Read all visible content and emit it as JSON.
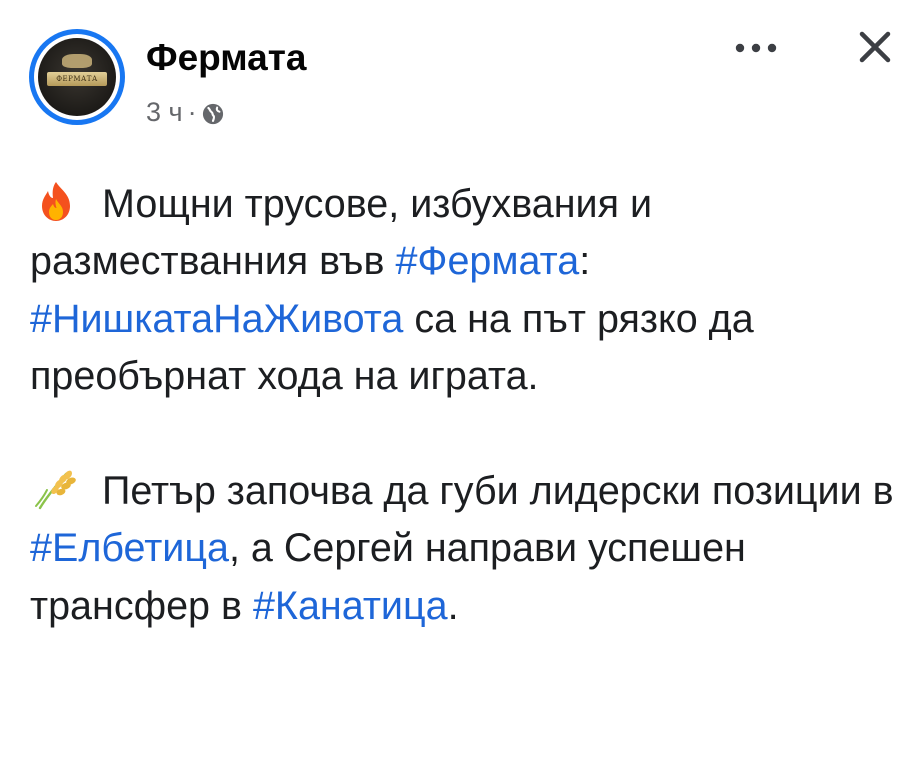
{
  "post": {
    "page_name": "Фермата",
    "avatar_label": "ФЕРМАТА",
    "time": "3 ч",
    "separator": "·",
    "privacy_icon": "globe-icon",
    "more_icon": "more-horizontal-icon",
    "close_icon": "close-icon"
  },
  "content": {
    "p1": {
      "emoji": "fire-emoji",
      "text_a": "Мощни трусове, избухвания и разместванния във ",
      "hashtag_1": "#Фермата",
      "text_b": ": ",
      "hashtag_2": "#НишкатаНаЖивота",
      "text_c": " са на път рязко да преобърнат хода на играта."
    },
    "p2": {
      "emoji": "sheaf-of-rice-emoji",
      "text_a": "Петър започва да губи лидерски позиции в ",
      "hashtag_1": "#Елбетица",
      "text_b": ", а Сергей направи успешен трансфер в ",
      "hashtag_2": "#Канатица",
      "text_c": "."
    }
  },
  "colors": {
    "hashtag": "#1e66d8",
    "text": "#1c1e21",
    "meta": "#65676b",
    "avatar_ring": "#1877f2"
  }
}
